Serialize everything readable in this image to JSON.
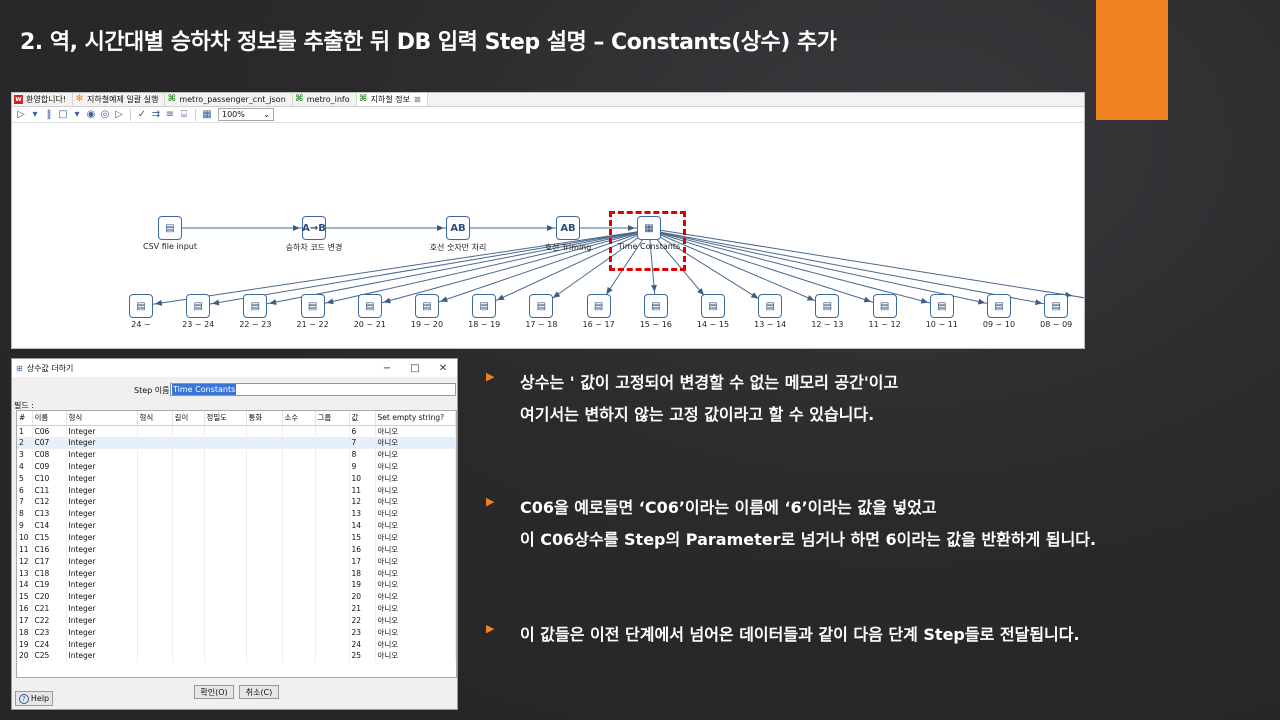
{
  "slide": {
    "title": "2. 역, 시간대별 승하차 정보를 추출한 뒤 DB 입력 Step 설명 – Constants(상수) 추가",
    "accent_color": "#f0811f"
  },
  "editor": {
    "tabs": [
      {
        "label": "환영합니다!",
        "icon": "welcome-icon"
      },
      {
        "label": "지하철예제 일괄 실행",
        "icon": "job-gear-icon"
      },
      {
        "label": "metro_passenger_cnt_json",
        "icon": "transformation-icon"
      },
      {
        "label": "metro_info",
        "icon": "transformation-icon"
      },
      {
        "label": "지하철 정보",
        "icon": "transformation-icon"
      }
    ],
    "zoom": "100%",
    "top_steps": [
      {
        "label": "CSV file input",
        "icon": "csv-input-icon",
        "glyph": "▤"
      },
      {
        "label": "승하차 코드 변경",
        "icon": "value-mapper-icon",
        "glyph": "A→B"
      },
      {
        "label": "호선 숫자만 처리",
        "icon": "string-ops-icon",
        "glyph": "AB"
      },
      {
        "label": "호선 Triming",
        "icon": "string-ops-icon",
        "glyph": "AB"
      },
      {
        "label": "Time Constants",
        "icon": "constants-icon",
        "glyph": "▦"
      }
    ],
    "bottom_steps": [
      "24 ~",
      "23 ~ 24",
      "22 ~ 23",
      "21 ~ 22",
      "20 ~ 21",
      "19 ~ 20",
      "18 ~ 19",
      "17 ~ 18",
      "16 ~ 17",
      "15 ~ 16",
      "14 ~ 15",
      "13 ~ 14",
      "12 ~ 13",
      "11 ~ 12",
      "10 ~ 11",
      "09 ~ 10",
      "08 ~ 09"
    ]
  },
  "dialog": {
    "title": "상수값 더하기",
    "step_name_label": "Step 이름",
    "step_name_value": "Time Constants",
    "fields_label": "필드 :",
    "columns": [
      "#",
      "이름",
      "형식",
      "형식",
      "길이",
      "정밀도",
      "통화",
      "소수",
      "그룹",
      "값",
      "Set empty string?"
    ],
    "rows": [
      [
        "1",
        "C06",
        "Integer",
        "6",
        "아니오"
      ],
      [
        "2",
        "C07",
        "Integer",
        "7",
        "아니오"
      ],
      [
        "3",
        "C08",
        "Integer",
        "8",
        "아니오"
      ],
      [
        "4",
        "C09",
        "Integer",
        "9",
        "아니오"
      ],
      [
        "5",
        "C10",
        "Integer",
        "10",
        "아니오"
      ],
      [
        "6",
        "C11",
        "Integer",
        "11",
        "아니오"
      ],
      [
        "7",
        "C12",
        "Integer",
        "12",
        "아니오"
      ],
      [
        "8",
        "C13",
        "Integer",
        "13",
        "아니오"
      ],
      [
        "9",
        "C14",
        "Integer",
        "14",
        "아니오"
      ],
      [
        "10",
        "C15",
        "Integer",
        "15",
        "아니오"
      ],
      [
        "11",
        "C16",
        "Integer",
        "16",
        "아니오"
      ],
      [
        "12",
        "C17",
        "Integer",
        "17",
        "아니오"
      ],
      [
        "13",
        "C18",
        "Integer",
        "18",
        "아니오"
      ],
      [
        "14",
        "C19",
        "Integer",
        "19",
        "아니오"
      ],
      [
        "15",
        "C20",
        "Integer",
        "20",
        "아니오"
      ],
      [
        "16",
        "C21",
        "Integer",
        "21",
        "아니오"
      ],
      [
        "17",
        "C22",
        "Integer",
        "22",
        "아니오"
      ],
      [
        "18",
        "C23",
        "Integer",
        "23",
        "아니오"
      ],
      [
        "19",
        "C24",
        "Integer",
        "24",
        "아니오"
      ],
      [
        "20",
        "C25",
        "Integer",
        "25",
        "아니오"
      ]
    ],
    "selected_row": 2,
    "ok_label": "확인(O)",
    "cancel_label": "취소(C)",
    "help_label": "Help"
  },
  "bullets": [
    {
      "lines": [
        "상수는 ' 값이 고정되어 변경할 수 없는 메모리 공간'이고",
        "여기서는 변하지 않는 고정 값이라고 할 수 있습니다."
      ]
    },
    {
      "lines": [
        "C06을 예로들면 ‘C06’이라는 이름에 ‘6’이라는 값을 넣었고",
        "이 C06상수를 Step의 Parameter로 넘거나 하면 6이라는 값을 반환하게 됩니다."
      ]
    },
    {
      "lines": [
        "이 값들은 이전 단계에서 넘어온 데이터들과 같이 다음 단계 Step들로 전달됩니다."
      ]
    }
  ]
}
